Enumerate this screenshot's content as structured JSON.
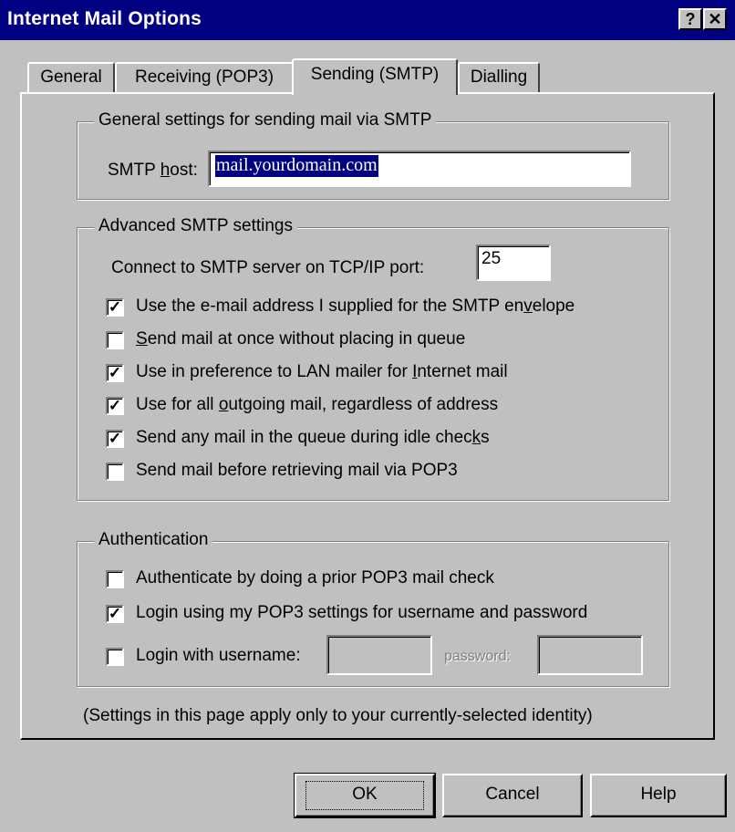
{
  "window": {
    "title": "Internet Mail Options",
    "help_glyph": "?",
    "close_glyph": "✕"
  },
  "tabs": [
    {
      "label": "General",
      "active": false
    },
    {
      "label": "Receiving (POP3)",
      "active": false
    },
    {
      "label": "Sending (SMTP)",
      "active": true
    },
    {
      "label": "Dialling",
      "active": false
    }
  ],
  "general_group": {
    "title": "General settings for sending mail via SMTP",
    "smtp_host_label_pre": "SMTP ",
    "smtp_host_label_mnemonic": "h",
    "smtp_host_label_post": "ost:",
    "smtp_host_value": "mail.yourdomain.com"
  },
  "advanced_group": {
    "title": "Advanced SMTP settings",
    "port_label": "Connect to SMTP server on TCP/IP port:",
    "port_value": "25",
    "options": [
      {
        "pre": "Use the e-mail address I supplied for the SMTP en",
        "mn": "v",
        "post": "elope",
        "checked": true
      },
      {
        "pre": "",
        "mn": "S",
        "post": "end mail at once without placing in queue",
        "checked": false
      },
      {
        "pre": "Use in preference to LAN mailer for ",
        "mn": "I",
        "post": "nternet mail",
        "checked": true
      },
      {
        "pre": "Use for all ",
        "mn": "o",
        "post": "utgoing mail, regardless of address",
        "checked": true
      },
      {
        "pre": "Send any mail in the queue during idle chec",
        "mn": "k",
        "post": "s",
        "checked": true
      },
      {
        "pre": "Send mail before retrieving mail via POP3",
        "mn": "",
        "post": "",
        "checked": false
      }
    ]
  },
  "auth_group": {
    "title": "Authentication",
    "options": [
      {
        "label": "Authenticate by doing a prior POP3 mail check",
        "checked": false
      },
      {
        "label": "Login using my POP3 settings for username and password",
        "checked": true
      },
      {
        "label": "Login with username:",
        "checked": false
      }
    ],
    "username_value": "",
    "password_label": "password:",
    "password_value": ""
  },
  "footnote": "(Settings in this page apply only to your currently-selected identity)",
  "buttons": {
    "ok": "OK",
    "cancel": "Cancel",
    "help": "Help"
  },
  "check_glyph": "✓",
  "colors": {
    "titlebar": "#000080",
    "face": "#c0c0c0",
    "selection": "#000080"
  }
}
